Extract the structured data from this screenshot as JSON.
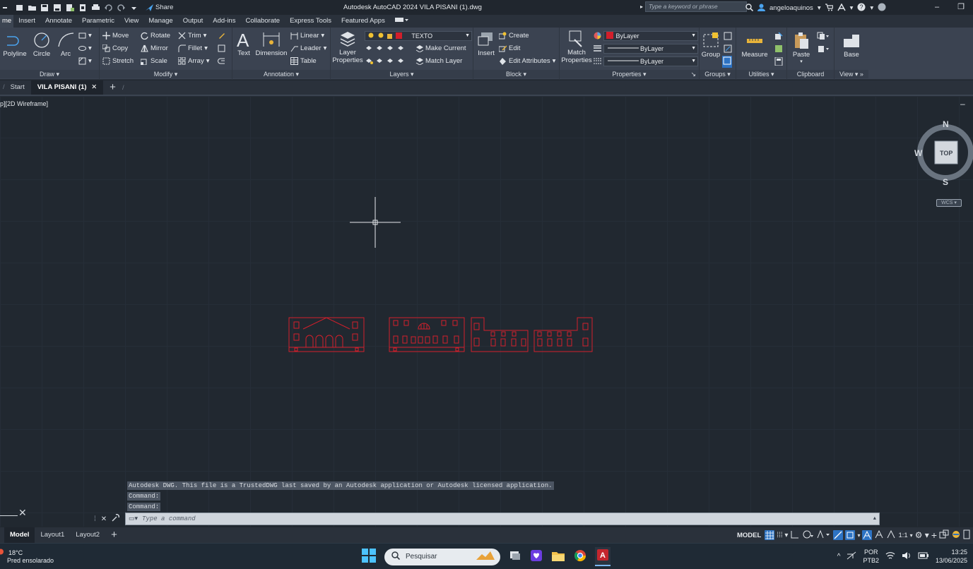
{
  "titlebar": {
    "share_label": "Share",
    "document_title": "Autodesk AutoCAD 2024   VILA PISANI (1).dwg",
    "search_placeholder": "Type a keyword or phrase",
    "username": "angeloaquinos"
  },
  "menu_tabs": [
    "me",
    "Insert",
    "Annotate",
    "Parametric",
    "View",
    "Manage",
    "Output",
    "Add-ins",
    "Collaborate",
    "Express Tools",
    "Featured Apps"
  ],
  "ribbon": {
    "draw": {
      "panel": "Draw",
      "polyline": "Polyline",
      "circle": "Circle",
      "arc": "Arc"
    },
    "modify": {
      "panel": "Modify",
      "move": "Move",
      "rotate": "Rotate",
      "trim": "Trim",
      "copy": "Copy",
      "mirror": "Mirror",
      "fillet": "Fillet",
      "stretch": "Stretch",
      "scale": "Scale",
      "array": "Array"
    },
    "annotation": {
      "panel": "Annotation",
      "text": "Text",
      "dimension": "Dimension",
      "linear": "Linear",
      "leader": "Leader",
      "table": "Table"
    },
    "layers": {
      "panel": "Layers",
      "layer_properties": "Layer Properties",
      "current_layer": "TEXTO",
      "make_current": "Make Current",
      "match_layer": "Match Layer"
    },
    "block": {
      "panel": "Block",
      "insert": "Insert",
      "create": "Create",
      "edit": "Edit",
      "edit_attributes": "Edit Attributes"
    },
    "properties": {
      "panel": "Properties",
      "match_properties": "Match Properties",
      "color": "ByLayer",
      "linetype": "ByLayer",
      "lineweight": "ByLayer"
    },
    "groups": {
      "panel": "Groups",
      "group": "Group"
    },
    "utilities": {
      "panel": "Utilities",
      "measure": "Measure"
    },
    "clipboard": {
      "panel": "Clipboard",
      "paste": "Paste"
    },
    "view": {
      "panel": "View",
      "base": "Base"
    }
  },
  "doc_tabs": {
    "start": "Start",
    "active": "VILA PISANI (1)"
  },
  "viewport": {
    "label": "p][2D Wireframe]",
    "viewcube": {
      "north": "N",
      "south": "S",
      "west": "W",
      "face": "TOP",
      "wcs": "WCS"
    }
  },
  "command": {
    "history": [
      "Autodesk DWG.  This file is a TrustedDWG last saved by an Autodesk application or Autodesk licensed application.",
      "Command:",
      "Command:"
    ],
    "input_placeholder": "Type a command"
  },
  "layout_tabs": [
    "Model",
    "Layout1",
    "Layout2"
  ],
  "status": {
    "model_label": "MODEL",
    "scale": "1:1"
  },
  "taskbar": {
    "temperature": "18°C",
    "weather": "Pred ensolarado",
    "search_placeholder": "Pesquisar",
    "lang_1": "POR",
    "lang_2": "PTB2",
    "time": "13:25",
    "date": "13/06/2025"
  },
  "colors": {
    "accent": "#2d73c4",
    "drawing_red": "#d21f2b",
    "canvas": "#212830",
    "ribbon": "#3b4351"
  }
}
